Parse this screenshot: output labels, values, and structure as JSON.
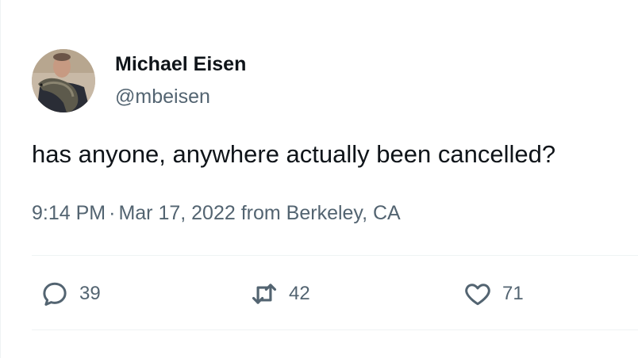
{
  "author": {
    "display_name": "Michael Eisen",
    "handle": "@mbeisen"
  },
  "tweet": {
    "text": "has anyone, anywhere actually been cancelled?",
    "time": "9:14 PM",
    "separator": "·",
    "date": "Mar 17, 2022",
    "source": "from Berkeley, CA"
  },
  "actions": {
    "reply": {
      "icon": "reply-icon",
      "count": "39"
    },
    "retweet": {
      "icon": "retweet-icon",
      "count": "42"
    },
    "like": {
      "icon": "heart-icon",
      "count": "71"
    }
  },
  "colors": {
    "text_primary": "#0f1419",
    "text_secondary": "#536471",
    "divider": "#eff3f4"
  }
}
